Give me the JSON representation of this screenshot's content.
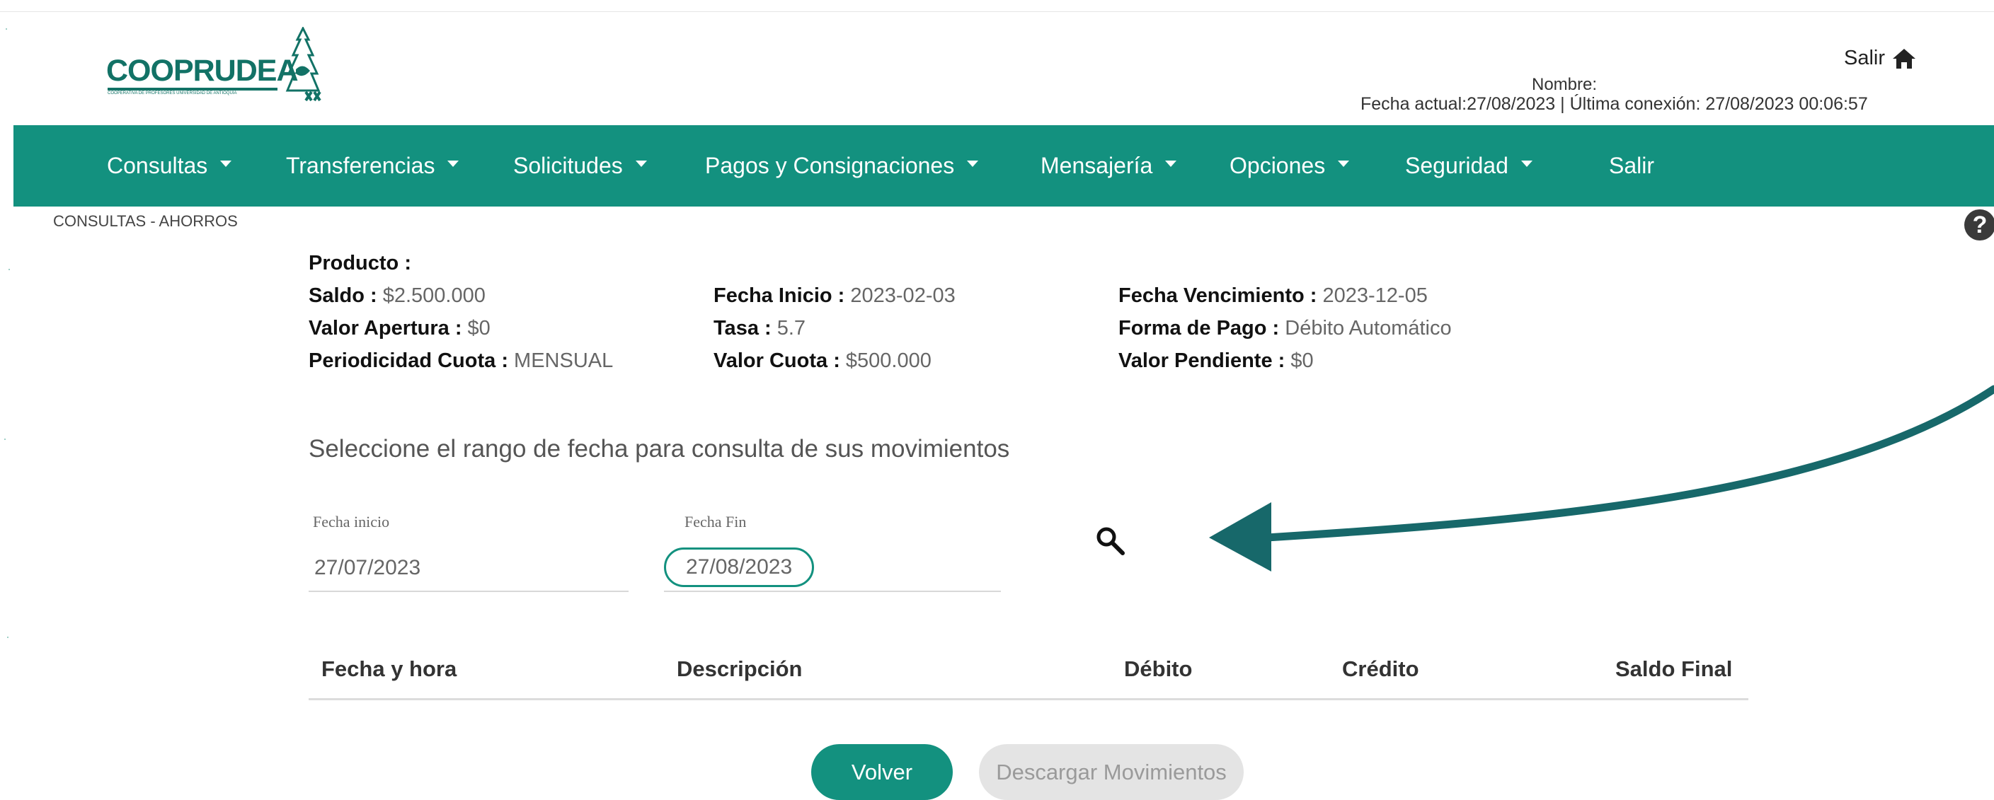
{
  "brand": {
    "name": "COOPRUDEA",
    "tagline": "COOPERATIVA DE PROFESORES UNIVERSIDAD DE ANTIOQUIA"
  },
  "header": {
    "logout_label": "Salir",
    "name_label": "Nombre:",
    "date_line": "Fecha actual:27/08/2023 | Última conexión: 27/08/2023 00:06:57"
  },
  "nav": {
    "items": [
      "Consultas",
      "Transferencias",
      "Solicitudes",
      "Pagos y Consignaciones",
      "Mensajería",
      "Opciones",
      "Seguridad"
    ],
    "logout": "Salir"
  },
  "breadcrumb": "CONSULTAS - AHORROS",
  "product": {
    "title": "Producto :",
    "col1": [
      {
        "label": "Saldo :",
        "value": "$2.500.000"
      },
      {
        "label": "Valor Apertura :",
        "value": "$0"
      },
      {
        "label": "Periodicidad Cuota :",
        "value": "MENSUAL"
      }
    ],
    "col2": [
      {
        "label": "Fecha Inicio :",
        "value": "2023-02-03"
      },
      {
        "label": "Tasa :",
        "value": "5.7"
      },
      {
        "label": "Valor Cuota :",
        "value": "$500.000"
      }
    ],
    "col3": [
      {
        "label": "Fecha Vencimiento :",
        "value": "2023-12-05"
      },
      {
        "label": "Forma de Pago :",
        "value": "Débito Automático"
      },
      {
        "label": "Valor Pendiente :",
        "value": "$0"
      }
    ]
  },
  "filter": {
    "instruction": "Seleccione el rango de fecha para consulta de sus movimientos",
    "start_label": "Fecha inicio",
    "start_value": "27/07/2023",
    "end_label": "Fecha Fin",
    "end_value": "27/08/2023"
  },
  "table": {
    "headers": [
      "Fecha y hora",
      "Descripción",
      "Débito",
      "Crédito",
      "Saldo Final"
    ]
  },
  "buttons": {
    "back": "Volver",
    "download": "Descargar Movimientos"
  },
  "colors": {
    "brand": "#13917f",
    "logo": "#127266",
    "arrow": "#17686a"
  }
}
